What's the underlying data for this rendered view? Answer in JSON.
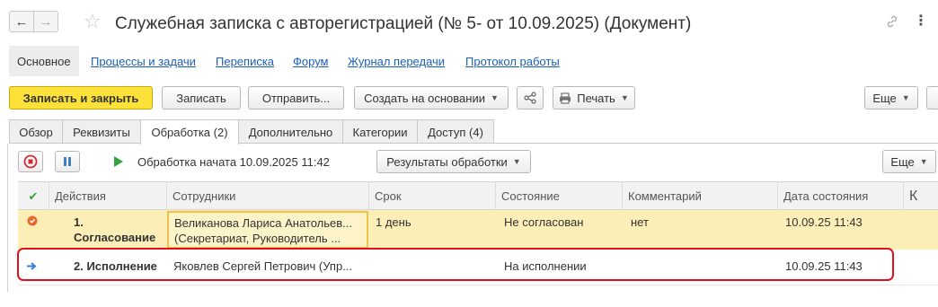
{
  "window": {
    "title": "Служебная записка с авторегистрацией (№ 5- от 10.09.2025) (Документ)",
    "back_icon": "←",
    "forward_icon": "→",
    "star_icon": "☆",
    "link_icon": "🔗",
    "more_icon": "⋮"
  },
  "sections": [
    {
      "label": "Основное",
      "active": true
    },
    {
      "label": "Процессы и задачи"
    },
    {
      "label": "Переписка"
    },
    {
      "label": "Форум"
    },
    {
      "label": "Журнал передачи"
    },
    {
      "label": "Протокол работы"
    }
  ],
  "toolbar": {
    "save_close": "Записать и закрыть",
    "save": "Записать",
    "send": "Отправить...",
    "create_based": "Создать на основании",
    "share_icon": "⋞",
    "print": "Печать",
    "more": "Еще"
  },
  "tabs": [
    {
      "label": "Обзор"
    },
    {
      "label": "Реквизиты"
    },
    {
      "label": "Обработка (2)",
      "active": true
    },
    {
      "label": "Дополнительно"
    },
    {
      "label": "Категории"
    },
    {
      "label": "Доступ (4)"
    }
  ],
  "process": {
    "status": "Обработка начата 10.09.2025 11:42",
    "results_label": "Результаты обработки",
    "more": "Еще"
  },
  "table": {
    "columns": [
      "Действия",
      "Сотрудники",
      "Срок",
      "Состояние",
      "Комментарий",
      "Дата состояния",
      "К"
    ],
    "check_icon": "✔",
    "rows": [
      {
        "action_line1": "1.",
        "action_line2": "Согласование",
        "employees_line1": "Великанова Лариса Анатольев...",
        "employees_line2": "(Секретариат, Руководитель ...",
        "term": "1 день",
        "state": "Не согласован",
        "comment": "нет",
        "state_date": "10.09.25 11:43",
        "status_color": "#e8692c"
      },
      {
        "action": "2. Исполнение",
        "employees": "Яковлев Сергей Петрович (Упр...",
        "term": "",
        "state": "На исполнении",
        "comment": "",
        "state_date": "10.09.25 11:43",
        "status_color": "#3b7fd4"
      }
    ]
  },
  "colors": {
    "primary_button": "#fce13a",
    "link": "#1b5fb5",
    "highlight_row": "#fbeeb7",
    "annotation": "#e0101c"
  }
}
